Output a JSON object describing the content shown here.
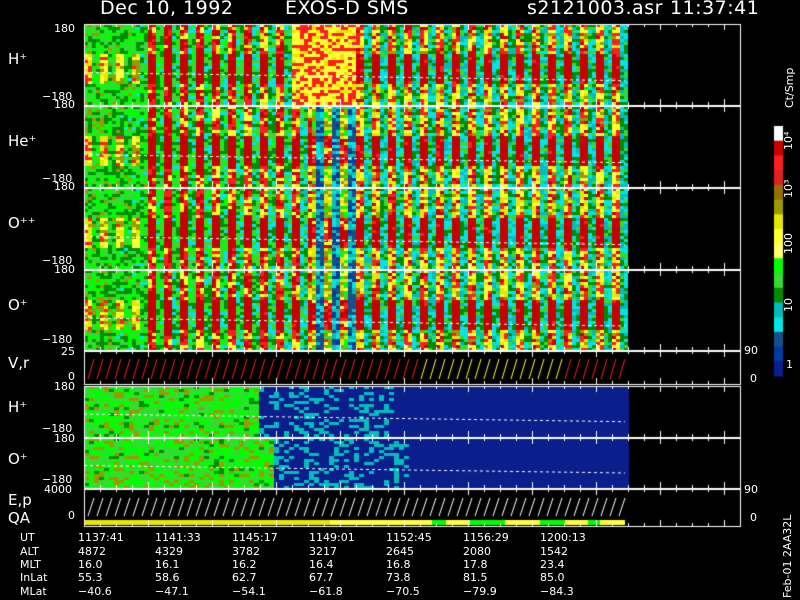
{
  "header": {
    "date": "Dec 10, 1992",
    "instrument": "EXOS-D SMS",
    "file": "s2121003.asr",
    "time": "11:37:41"
  },
  "panels": [
    {
      "label": "H⁺",
      "top_tick": "180",
      "bottom_tick": "−180"
    },
    {
      "label": "He⁺",
      "top_tick": "180",
      "bottom_tick": "−180"
    },
    {
      "label": "O⁺⁺",
      "top_tick": "180",
      "bottom_tick": "−180"
    },
    {
      "label": "O⁺",
      "top_tick": "180",
      "bottom_tick": "−180"
    },
    {
      "label": "V,r",
      "top_tick": "25",
      "bottom_tick": "0",
      "right_top": "90",
      "right_bottom": "0"
    },
    {
      "label": "H⁺",
      "top_tick": "180",
      "bottom_tick": "−180"
    },
    {
      "label": "O⁺",
      "top_tick": "180",
      "bottom_tick": "−180"
    },
    {
      "label": "E,p",
      "label2": "QA",
      "top_tick": "4000",
      "bottom_tick": "0",
      "right_top": "90",
      "right_bottom": "0"
    }
  ],
  "colorbar": {
    "units": "Ct/Smp",
    "labels": [
      "10⁴",
      "10³",
      "100",
      "10",
      "1"
    ],
    "colors": [
      "#ffffff",
      "#c80000",
      "#ff1e1e",
      "#e02020",
      "#967000",
      "#9a9a00",
      "#e6e600",
      "#ffff32",
      "#ffff6e",
      "#00ff00",
      "#32dc32",
      "#008c00",
      "#00bebe",
      "#00e6e6",
      "#14508c",
      "#003ca0",
      "#0a1e8c"
    ]
  },
  "chart_data": {
    "type": "heatmap",
    "title": "Dec 10, 1992   EXOS-D SMS",
    "subtitle": "s2121003.asr  11:37:41",
    "series": [
      {
        "name": "H⁺",
        "ylim": [
          -180,
          180
        ]
      },
      {
        "name": "He⁺",
        "ylim": [
          -180,
          180
        ]
      },
      {
        "name": "O⁺⁺",
        "ylim": [
          -180,
          180
        ]
      },
      {
        "name": "O⁺",
        "ylim": [
          -180,
          180
        ]
      },
      {
        "name": "V,r",
        "ylim": [
          0,
          25
        ]
      },
      {
        "name": "H⁺",
        "ylim": [
          -180,
          180
        ]
      },
      {
        "name": "O⁺",
        "ylim": [
          -180,
          180
        ]
      },
      {
        "name": "E,p",
        "ylim": [
          0,
          4000
        ]
      }
    ],
    "colorscale": {
      "label": "Ct/Smp",
      "range": [
        1,
        10000
      ],
      "scale": "log"
    },
    "ephemeris": {
      "UT": [
        "1137:41",
        "1141:33",
        "1145:17",
        "1149:01",
        "1152:45",
        "1156:29",
        "1200:13"
      ],
      "ALT": [
        "4872",
        "4329",
        "3782",
        "3217",
        "2645",
        "2080",
        "1542"
      ],
      "MLT": [
        "16.0",
        "16.1",
        "16.2",
        "16.4",
        "16.8",
        "17.8",
        "23.4"
      ],
      "InLat": [
        "55.3",
        "58.6",
        "62.7",
        "67.7",
        "73.8",
        "81.5",
        "85.0"
      ],
      "MLat": [
        "−40.6",
        "−47.1",
        "−54.1",
        "−61.8",
        "−70.5",
        "−79.9",
        "−84.3"
      ]
    }
  },
  "ephemeris_labels": [
    "UT",
    "ALT",
    "MLT",
    "InLat",
    "MLat"
  ],
  "footer_id": "Feb-01 2AA32L"
}
